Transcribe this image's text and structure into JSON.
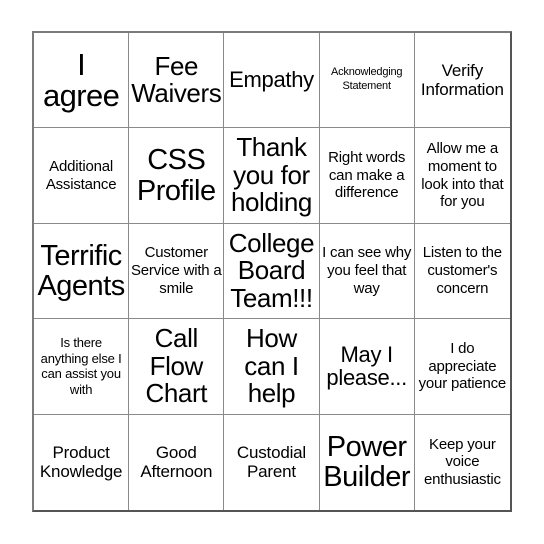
{
  "card": {
    "type": "bingo-card",
    "columns": 5,
    "rows": 5,
    "background_color": "#ffffff",
    "text_color": "#000000",
    "border_color": "#7b7b7b",
    "grid_line_color": "#8a8a8a",
    "cells": [
      [
        {
          "text": "I agree",
          "size": "fs-xxl"
        },
        {
          "text": "Fee Waivers",
          "size": "fs-lg"
        },
        {
          "text": "Empathy",
          "size": "fs-md"
        },
        {
          "text": "Acknowledging Statement",
          "size": "fs-tiny"
        },
        {
          "text": "Verify Information",
          "size": "fs-sm"
        }
      ],
      [
        {
          "text": "Additional Assistance",
          "size": "fs-xs"
        },
        {
          "text": "CSS Profile",
          "size": "fs-xl"
        },
        {
          "text": "Thank you for holding",
          "size": "fs-lg"
        },
        {
          "text": "Right words can make a difference",
          "size": "fs-xs"
        },
        {
          "text": "Allow me a moment to look into that for you",
          "size": "fs-xs"
        }
      ],
      [
        {
          "text": "Terrific Agents",
          "size": "fs-xl"
        },
        {
          "text": "Customer Service with a smile",
          "size": "fs-xs"
        },
        {
          "text": "College Board Team!!!",
          "size": "fs-lg"
        },
        {
          "text": "I can see why you feel that way",
          "size": "fs-xs"
        },
        {
          "text": "Listen to the customer's concern",
          "size": "fs-xs"
        }
      ],
      [
        {
          "text": "Is there anything else I can assist you with",
          "size": "fs-xxs"
        },
        {
          "text": "Call Flow Chart",
          "size": "fs-lg"
        },
        {
          "text": "How can I help",
          "size": "fs-lg"
        },
        {
          "text": "May I please...",
          "size": "fs-md"
        },
        {
          "text": "I do appreciate your patience",
          "size": "fs-xs"
        }
      ],
      [
        {
          "text": "Product Knowledge",
          "size": "fs-sm"
        },
        {
          "text": "Good Afternoon",
          "size": "fs-sm"
        },
        {
          "text": "Custodial Parent",
          "size": "fs-sm"
        },
        {
          "text": "Power Builder",
          "size": "fs-xl"
        },
        {
          "text": "Keep your voice enthusiastic",
          "size": "fs-xs"
        }
      ]
    ]
  }
}
